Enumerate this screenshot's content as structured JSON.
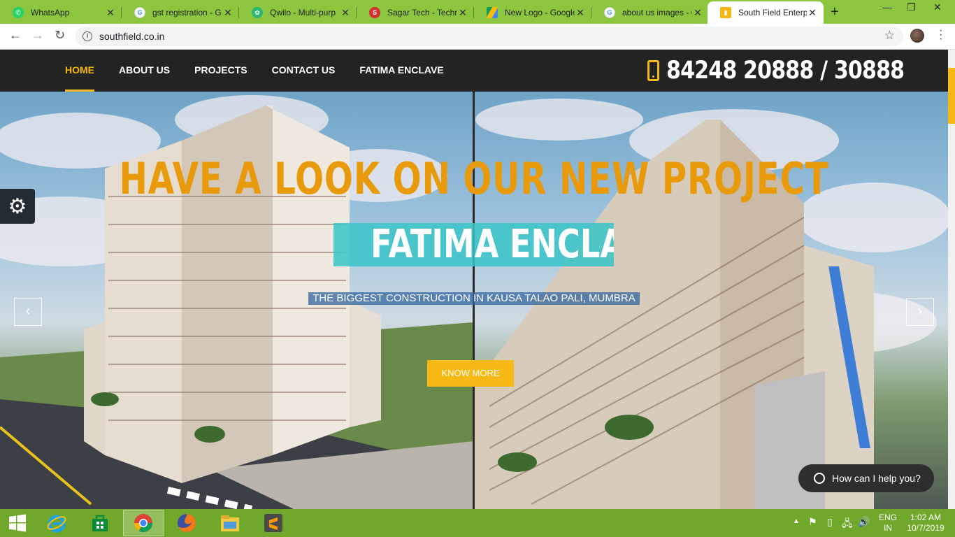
{
  "browser": {
    "tabs": [
      {
        "title": "WhatsApp",
        "icon": "whatsapp-icon",
        "color": "#25d366"
      },
      {
        "title": "gst registration - G",
        "icon": "google-icon",
        "color": "#4285f4"
      },
      {
        "title": "Qwilo - Multi-purp",
        "icon": "qwilo-icon",
        "color": "#2bb673"
      },
      {
        "title": "Sagar Tech - Techn",
        "icon": "sagartech-icon",
        "color": "#d32f2f"
      },
      {
        "title": "New Logo - Google",
        "icon": "google-drive-icon",
        "color": "#fbbc04"
      },
      {
        "title": "about us images - G",
        "icon": "google-icon",
        "color": "#4285f4"
      },
      {
        "title": "South Field Enterpr",
        "icon": "southfield-icon",
        "color": "#f6b812",
        "active": true
      }
    ],
    "url": "southfield.co.in"
  },
  "site": {
    "nav": [
      {
        "label": "HOME",
        "active": true
      },
      {
        "label": "ABOUT US"
      },
      {
        "label": "PROJECTS"
      },
      {
        "label": "CONTACT US"
      },
      {
        "label": "FATIMA ENCLAVE"
      }
    ],
    "phone": "84248 20888 / 30888",
    "accent_color": "#f6b812"
  },
  "hero": {
    "heading": "HAVE A LOOK ON OUR NEW PROJECT",
    "project_name": "FATIMA ENCLAVE",
    "tagline": "THE BIGGEST CONSTRUCTION IN KAUSA TALAO PALI, MUMBRA",
    "cta": "KNOW MORE",
    "prev": "‹",
    "next": "›"
  },
  "chat_widget": {
    "label": "How can I help you?"
  },
  "taskbar": {
    "apps": [
      "start-button",
      "internet-explorer-icon",
      "store-icon",
      "chrome-icon",
      "firefox-icon",
      "file-explorer-icon",
      "sublime-text-icon"
    ],
    "language_line1": "ENG",
    "language_line2": "IN",
    "time": "1:02 AM",
    "date": "10/7/2019"
  }
}
